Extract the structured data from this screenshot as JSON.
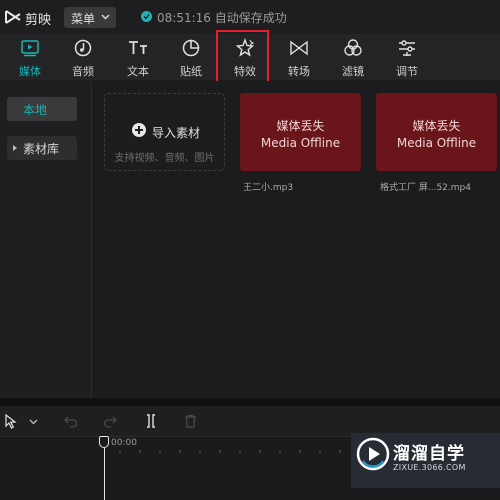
{
  "app": {
    "name": "剪映",
    "menu_label": "菜单",
    "save_status": "08:51:16 自动保存成功"
  },
  "toolbar": {
    "tools": [
      {
        "label": "媒体",
        "icon": "media-icon"
      },
      {
        "label": "音频",
        "icon": "audio-icon"
      },
      {
        "label": "文本",
        "icon": "text-icon"
      },
      {
        "label": "贴纸",
        "icon": "sticker-icon"
      },
      {
        "label": "特效",
        "icon": "effects-icon"
      },
      {
        "label": "转场",
        "icon": "transition-icon"
      },
      {
        "label": "滤镜",
        "icon": "filter-icon"
      },
      {
        "label": "调节",
        "icon": "adjust-icon"
      }
    ],
    "active": "媒体",
    "highlighted": "特效"
  },
  "sidebar": {
    "items": [
      {
        "label": "本地"
      },
      {
        "label": "素材库"
      }
    ]
  },
  "media": {
    "import_title": "导入素材",
    "import_hint": "支持视频、音频、图片",
    "items": [
      {
        "title_cn": "媒体丢失",
        "title_en": "Media Offline",
        "filename": "王二小.mp3"
      },
      {
        "title_cn": "媒体丢失",
        "title_en": "Media Offline",
        "filename": "格式工厂 屏...52.mp4"
      }
    ]
  },
  "timeline": {
    "time": "00:00"
  },
  "watermark": {
    "brand": "溜溜自学",
    "url": "ZIXUE.3066.COM"
  },
  "colors": {
    "accent": "#19b4b7",
    "offline_card": "#6a1519",
    "highlight_box": "#e8202a"
  }
}
